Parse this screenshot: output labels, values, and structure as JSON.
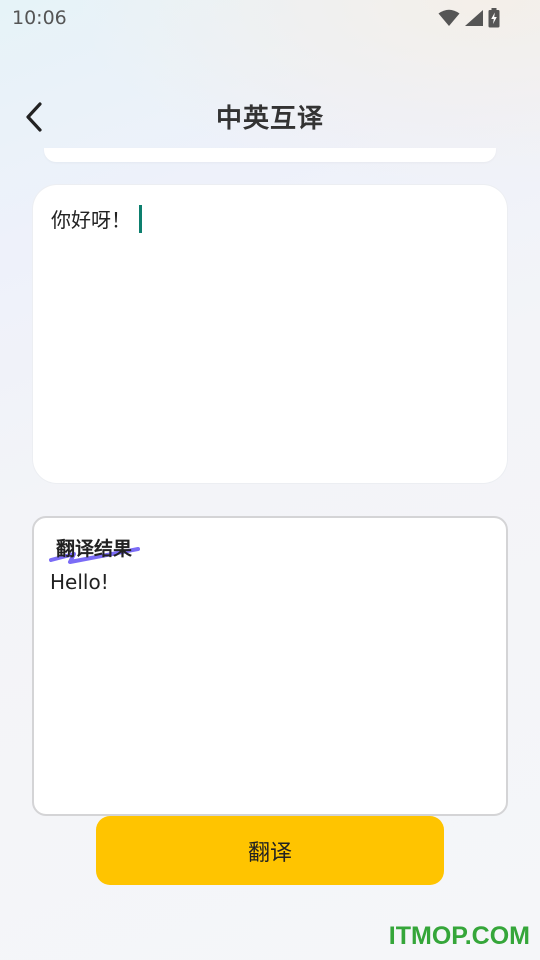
{
  "status_bar": {
    "time": "10:06",
    "icons": [
      "wifi-icon",
      "cellular-signal-icon",
      "battery-charging-icon"
    ]
  },
  "header": {
    "back_icon": "chevron-left-icon",
    "title": "中英互译"
  },
  "input": {
    "value": "你好呀！"
  },
  "result": {
    "title": "翻译结果",
    "text": "Hello!"
  },
  "actions": {
    "translate_label": "翻译"
  },
  "watermark": "ITMOP.COM",
  "colors": {
    "accent_button": "#ffc400",
    "cursor": "#0d7f6e",
    "title_underline": "#7b6cf6",
    "watermark": "#35a63a"
  }
}
